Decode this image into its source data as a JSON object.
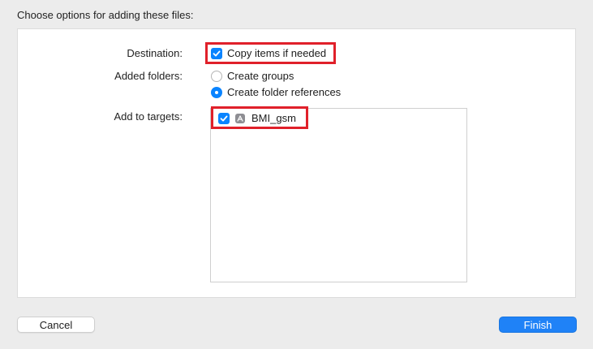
{
  "dialog": {
    "title": "Choose options for adding these files:"
  },
  "destination": {
    "label": "Destination:",
    "copy_items_label": "Copy items if needed",
    "copy_items_checked": true
  },
  "added_folders": {
    "label": "Added folders:",
    "options": [
      {
        "label": "Create groups",
        "selected": false
      },
      {
        "label": "Create folder references",
        "selected": true
      }
    ]
  },
  "targets": {
    "label": "Add to targets:",
    "items": [
      {
        "label": "BMI_gsm",
        "checked": true,
        "icon": "app-target-icon"
      }
    ]
  },
  "buttons": {
    "cancel": "Cancel",
    "finish": "Finish"
  },
  "colors": {
    "accent": "#0a84ff",
    "highlight": "#e0202a",
    "finish_button": "#1f82f7"
  }
}
